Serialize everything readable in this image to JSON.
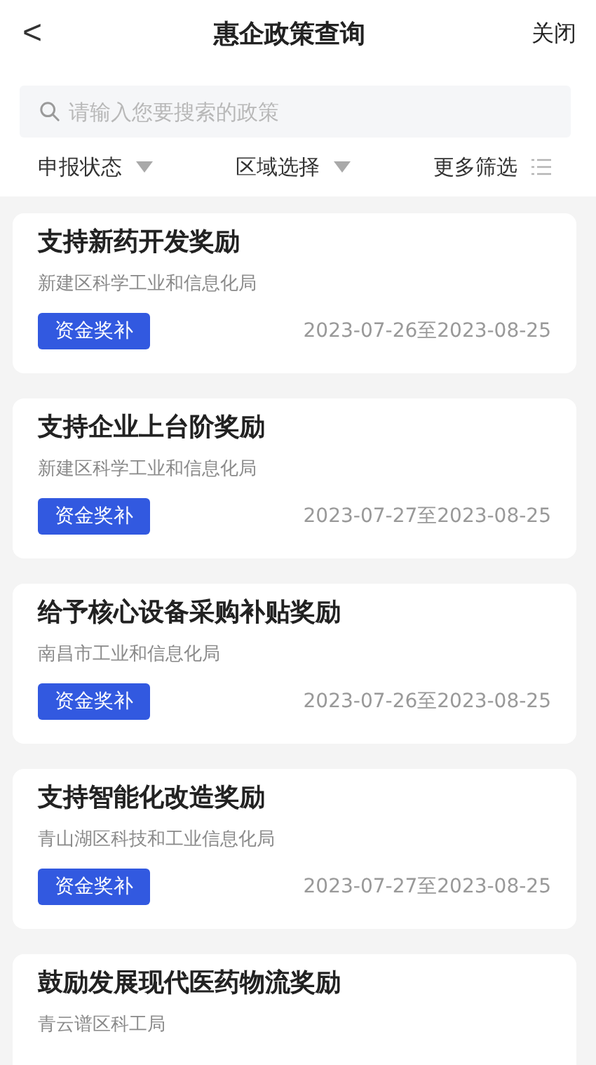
{
  "header": {
    "back": "<",
    "title": "惠企政策查询",
    "close": "关闭"
  },
  "search": {
    "placeholder": "请输入您要搜索的政策"
  },
  "filters": [
    {
      "label": "申报状态",
      "kind": "dropdown"
    },
    {
      "label": "区域选择",
      "kind": "dropdown"
    },
    {
      "label": "更多筛选",
      "kind": "list"
    }
  ],
  "policies": [
    {
      "title": "支持新药开发奖励",
      "department": "新建区科学工业和信息化局",
      "tag": "资金奖补",
      "period": "2023-07-26至2023-08-25"
    },
    {
      "title": "支持企业上台阶奖励",
      "department": "新建区科学工业和信息化局",
      "tag": "资金奖补",
      "period": "2023-07-27至2023-08-25"
    },
    {
      "title": "给予核心设备采购补贴奖励",
      "department": "南昌市工业和信息化局",
      "tag": "资金奖补",
      "period": "2023-07-26至2023-08-25"
    },
    {
      "title": "支持智能化改造奖励",
      "department": "青山湖区科技和工业信息化局",
      "tag": "资金奖补",
      "period": "2023-07-27至2023-08-25"
    },
    {
      "title": "鼓励发展现代医药物流奖励",
      "department": "青云谱区科工局"
    }
  ]
}
